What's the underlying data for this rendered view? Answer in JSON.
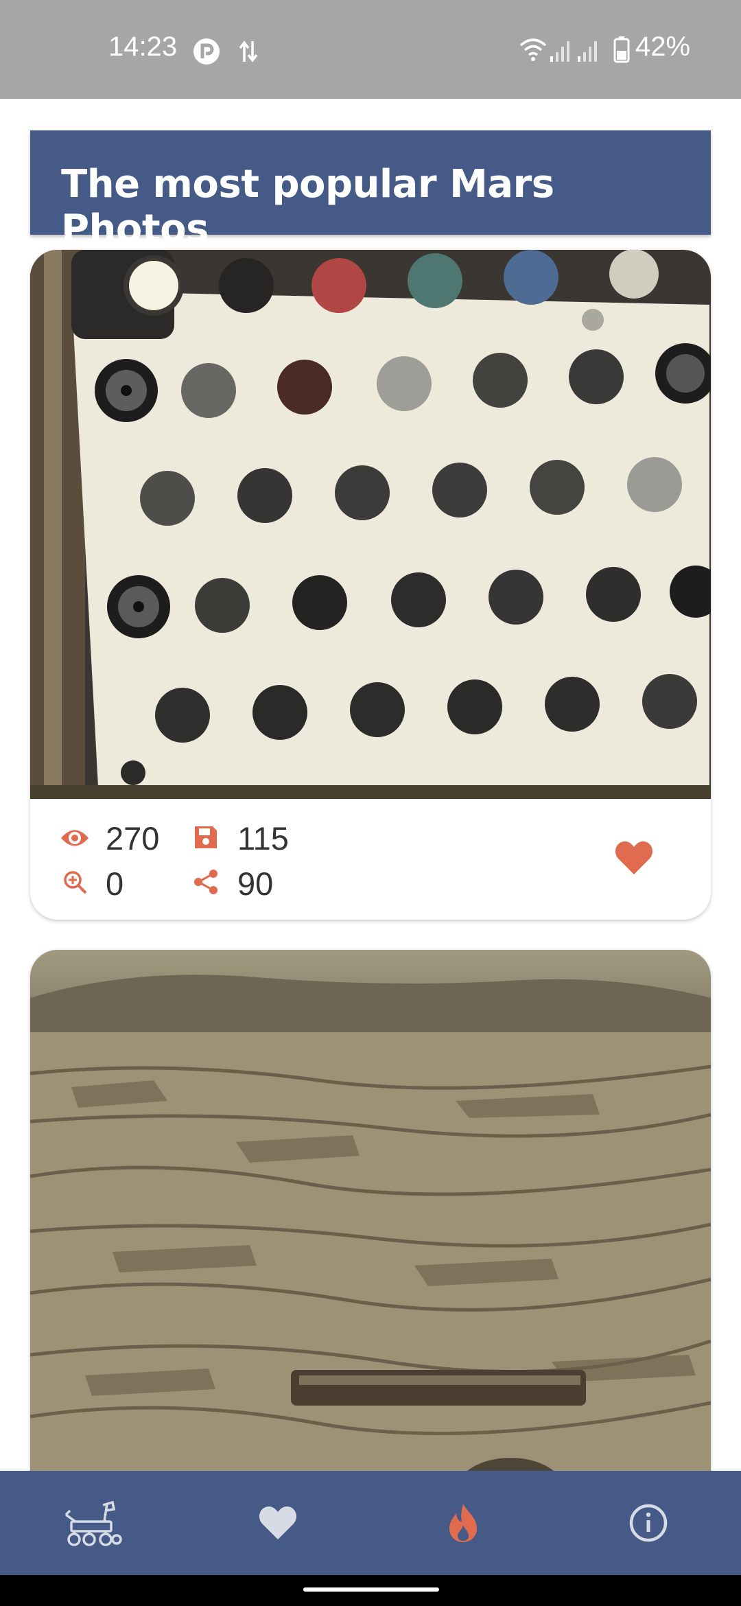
{
  "status_bar": {
    "time": "14:23",
    "battery": "42%",
    "icons": [
      "app-notification-icon",
      "data-transfer-icon",
      "wifi-icon",
      "signal-icon",
      "signal-icon",
      "battery-icon"
    ]
  },
  "header": {
    "title": "The most popular Mars Photos"
  },
  "cards": [
    {
      "views": "270",
      "saves": "115",
      "zooms": "0",
      "shares": "90",
      "favorite": true
    },
    {}
  ],
  "bottom_nav": {
    "items": [
      {
        "icon": "rover-icon",
        "active": false
      },
      {
        "icon": "heart-icon",
        "active": false
      },
      {
        "icon": "fire-icon",
        "active": true
      },
      {
        "icon": "info-icon",
        "active": false
      }
    ]
  },
  "colors": {
    "primary": "#455a86",
    "accent": "#e06b4f",
    "nav_inactive": "#d7dbe6"
  }
}
